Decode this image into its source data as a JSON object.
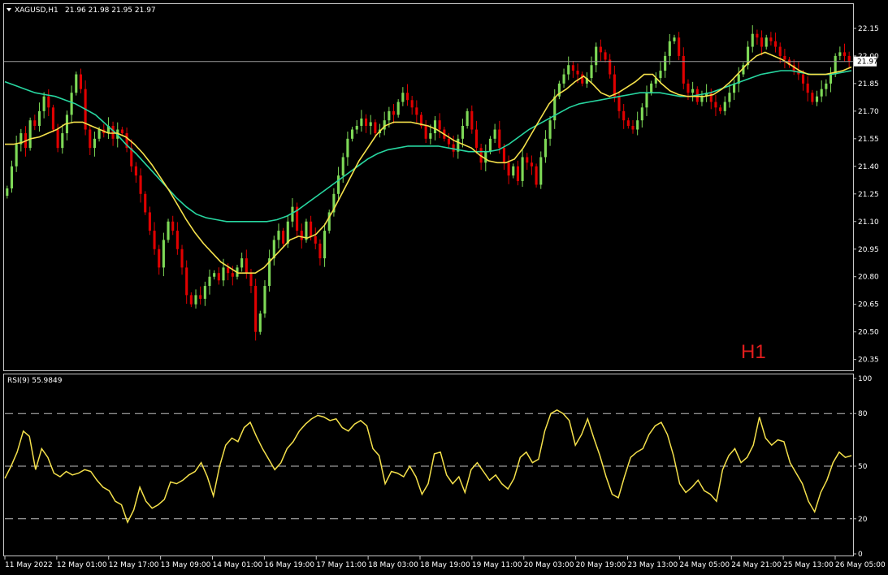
{
  "header": {
    "symbol": "XAGUSD,H1",
    "ohlc": "21.96 21.98 21.95 21.97"
  },
  "timeframe_label": "H1",
  "rsi_header": "RSI(9) 55.9849",
  "last_price_label": "21.97",
  "colors": {
    "background": "#000000",
    "bull_candle": "#7ed957",
    "bear_candle": "#e00000",
    "ma_fast": "#f5e14b",
    "ma_slow": "#27d6a0",
    "rsi_line": "#f5e14b",
    "frame": "#c8c8c8",
    "timeframe_text": "#e11d1d"
  },
  "chart_data": [
    {
      "type": "candlestick",
      "title": "XAGUSD,H1",
      "ylim": [
        20.3,
        22.26
      ],
      "y_ticks": [
        "22.15",
        "22.00",
        "21.85",
        "21.70",
        "21.55",
        "21.40",
        "21.25",
        "21.10",
        "20.95",
        "20.80",
        "20.65",
        "20.50",
        "20.35"
      ],
      "x_ticks": [
        "11 May 2022",
        "12 May 01:00",
        "12 May 17:00",
        "13 May 09:00",
        "14 May 01:00",
        "16 May 19:00",
        "17 May 11:00",
        "18 May 03:00",
        "18 May 19:00",
        "19 May 11:00",
        "20 May 03:00",
        "20 May 19:00",
        "23 May 13:00",
        "24 May 05:00",
        "24 May 21:00",
        "25 May 13:00",
        "26 May 05:00"
      ],
      "close": [
        21.28,
        21.4,
        21.52,
        21.58,
        21.5,
        21.65,
        21.62,
        21.7,
        21.78,
        21.72,
        21.6,
        21.5,
        21.58,
        21.68,
        21.8,
        21.9,
        21.82,
        21.6,
        21.5,
        21.55,
        21.6,
        21.58,
        21.62,
        21.55,
        21.6,
        21.58,
        21.5,
        21.4,
        21.35,
        21.25,
        21.15,
        21.05,
        20.95,
        20.85,
        21.0,
        21.1,
        21.05,
        20.95,
        20.85,
        20.7,
        20.65,
        20.7,
        20.68,
        20.75,
        20.8,
        20.82,
        20.78,
        20.85,
        20.82,
        20.8,
        20.85,
        20.9,
        20.82,
        20.75,
        20.5,
        20.6,
        20.75,
        20.9,
        21.0,
        21.05,
        20.98,
        21.1,
        21.18,
        21.05,
        21.0,
        21.1,
        21.02,
        20.98,
        20.9,
        21.05,
        21.15,
        21.25,
        21.35,
        21.45,
        21.55,
        21.6,
        21.62,
        21.66,
        21.62,
        21.64,
        21.58,
        21.6,
        21.65,
        21.7,
        21.68,
        21.75,
        21.8,
        21.76,
        21.72,
        21.68,
        21.62,
        21.55,
        21.58,
        21.65,
        21.6,
        21.55,
        21.52,
        21.48,
        21.55,
        21.62,
        21.7,
        21.6,
        21.5,
        21.42,
        21.48,
        21.55,
        21.6,
        21.5,
        21.42,
        21.35,
        21.4,
        21.32,
        21.45,
        21.42,
        21.4,
        21.3,
        21.45,
        21.55,
        21.65,
        21.78,
        21.85,
        21.9,
        21.95,
        21.92,
        21.9,
        21.85,
        21.88,
        21.95,
        22.05,
        22.02,
        21.98,
        21.9,
        21.78,
        21.7,
        21.65,
        21.62,
        21.6,
        21.65,
        21.72,
        21.8,
        21.85,
        21.88,
        21.92,
        22.0,
        22.08,
        22.1,
        22.0,
        21.85,
        21.8,
        21.82,
        21.75,
        21.78,
        21.8,
        21.75,
        21.72,
        21.7,
        21.75,
        21.8,
        21.85,
        21.9,
        21.95,
        22.05,
        22.12,
        22.1,
        22.05,
        22.1,
        22.08,
        22.05,
        22.0,
        21.98,
        21.95,
        21.92,
        21.9,
        21.85,
        21.8,
        21.75,
        21.78,
        21.82,
        21.85,
        21.9,
        22.0,
        22.02,
        22.0,
        21.97
      ],
      "ma_fast": [
        21.52,
        21.52,
        21.53,
        21.55,
        21.56,
        21.58,
        21.6,
        21.63,
        21.64,
        21.64,
        21.62,
        21.6,
        21.58,
        21.58,
        21.56,
        21.52,
        21.47,
        21.41,
        21.34,
        21.27,
        21.19,
        21.11,
        21.04,
        20.98,
        20.93,
        20.88,
        20.85,
        20.82,
        20.82,
        20.82,
        20.85,
        20.9,
        20.95,
        21.0,
        21.02,
        21.01,
        21.03,
        21.08,
        21.16,
        21.25,
        21.34,
        21.43,
        21.5,
        21.57,
        21.62,
        21.64,
        21.64,
        21.64,
        21.63,
        21.62,
        21.6,
        21.57,
        21.54,
        21.52,
        21.5,
        21.46,
        21.43,
        21.42,
        21.42,
        21.44,
        21.5,
        21.58,
        21.66,
        21.74,
        21.79,
        21.82,
        21.86,
        21.89,
        21.85,
        21.8,
        21.78,
        21.8,
        21.83,
        21.86,
        21.9,
        21.9,
        21.85,
        21.81,
        21.79,
        21.78,
        21.78,
        21.78,
        21.79,
        21.82,
        21.86,
        21.91,
        21.96,
        22.0,
        22.02,
        22.0,
        21.98,
        21.95,
        21.92,
        21.9,
        21.9,
        21.9,
        21.91,
        21.92,
        21.94
      ],
      "ma_slow": [
        21.86,
        21.84,
        21.82,
        21.8,
        21.79,
        21.78,
        21.76,
        21.74,
        21.71,
        21.68,
        21.63,
        21.58,
        21.52,
        21.47,
        21.41,
        21.35,
        21.29,
        21.23,
        21.18,
        21.14,
        21.12,
        21.11,
        21.1,
        21.1,
        21.1,
        21.1,
        21.1,
        21.11,
        21.13,
        21.16,
        21.2,
        21.24,
        21.28,
        21.32,
        21.36,
        21.4,
        21.44,
        21.47,
        21.49,
        21.5,
        21.51,
        21.51,
        21.51,
        21.51,
        21.5,
        21.49,
        21.48,
        21.48,
        21.48,
        21.49,
        21.52,
        21.56,
        21.6,
        21.63,
        21.66,
        21.69,
        21.72,
        21.74,
        21.75,
        21.76,
        21.77,
        21.78,
        21.79,
        21.8,
        21.8,
        21.8,
        21.79,
        21.78,
        21.78,
        21.79,
        21.8,
        21.82,
        21.84,
        21.86,
        21.88,
        21.9,
        21.91,
        21.92,
        21.92,
        21.91,
        21.9,
        21.9,
        21.9,
        21.91,
        21.92
      ]
    },
    {
      "type": "line",
      "title": "RSI(9) 55.9849",
      "ylim": [
        0,
        100
      ],
      "y_ticks": [
        100,
        80,
        50,
        20,
        0
      ],
      "levels": [
        80,
        50,
        20
      ],
      "values": [
        43,
        50,
        58,
        70,
        67,
        48,
        60,
        55,
        46,
        44,
        47,
        45,
        46,
        48,
        47,
        42,
        38,
        36,
        30,
        28,
        18,
        25,
        38,
        30,
        26,
        28,
        31,
        41,
        40,
        42,
        45,
        47,
        52,
        44,
        33,
        50,
        62,
        66,
        64,
        72,
        75,
        67,
        60,
        54,
        48,
        52,
        60,
        64,
        70,
        74,
        77,
        79,
        78,
        76,
        77,
        72,
        70,
        74,
        76,
        73,
        60,
        56,
        40,
        47,
        46,
        44,
        50,
        44,
        34,
        40,
        57,
        58,
        45,
        40,
        44,
        35,
        48,
        52,
        47,
        42,
        45,
        40,
        37,
        43,
        55,
        58,
        52,
        54,
        70,
        80,
        82,
        80,
        76,
        62,
        68,
        77,
        66,
        56,
        44,
        34,
        32,
        44,
        55,
        58,
        60,
        68,
        73,
        75,
        68,
        56,
        40,
        35,
        38,
        42,
        36,
        34,
        30,
        48,
        56,
        60,
        52,
        55,
        62,
        78,
        66,
        62,
        65,
        64,
        52,
        46,
        40,
        30,
        24,
        35,
        42,
        52,
        58,
        55,
        56
      ]
    }
  ]
}
